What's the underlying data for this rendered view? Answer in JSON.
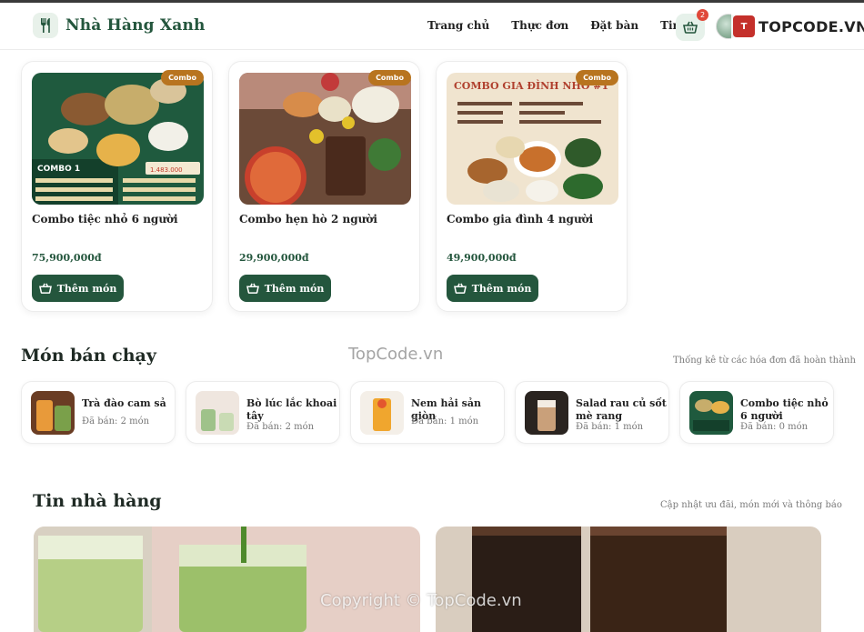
{
  "header": {
    "brand": "Nhà Hàng Xanh",
    "nav": [
      "Trang chủ",
      "Thực đơn",
      "Đặt bàn",
      "Tin tức"
    ],
    "cart_count": "2",
    "logo_icon": "utensils-icon",
    "cart_icon": "basket-icon"
  },
  "watermarks": {
    "brand_site": "TOPCODE.VN",
    "brand_icon_text": "T",
    "center": "TopCode.vn",
    "bottom": "Copyright © TopCode.vn"
  },
  "combos": [
    {
      "tag": "Combo",
      "name": "Combo tiệc nhỏ 6 người",
      "price": "75,900,000đ",
      "button": "Thêm món"
    },
    {
      "tag": "Combo",
      "name": "Combo hẹn hò 2 người",
      "price": "29,900,000đ",
      "button": "Thêm món"
    },
    {
      "tag": "Combo",
      "name": "Combo gia đình 4 người",
      "price": "49,900,000đ",
      "button": "Thêm món"
    }
  ],
  "bestsellers": {
    "title": "Món bán chạy",
    "note": "Thống kê từ các hóa đơn đã hoàn thành",
    "items": [
      {
        "name": "Trà đào cam sả",
        "sold": "Đã bán: 2 món"
      },
      {
        "name": "Bò lúc lắc khoai tây",
        "sold": "Đã bán: 2 món"
      },
      {
        "name": "Nem hải sản giòn",
        "sold": "Đã bán: 1 món"
      },
      {
        "name": "Salad rau củ sốt mè rang",
        "sold": "Đã bán: 1 món"
      },
      {
        "name": "Combo tiệc nhỏ 6 người",
        "sold": "Đã bán: 0 món"
      }
    ]
  },
  "news": {
    "title": "Tin nhà hàng",
    "note": "Cập nhật ưu đãi, món mới và thông báo"
  },
  "colors": {
    "primary": "#24563d",
    "accent": "#b8741f",
    "badge": "#e0483a"
  }
}
